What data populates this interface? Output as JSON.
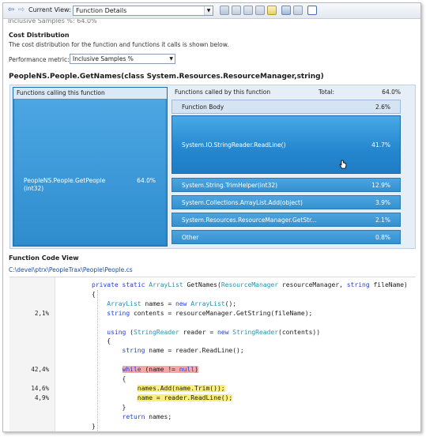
{
  "toolbar": {
    "back_icon": "back-arrow-icon",
    "forward_icon": "forward-arrow-icon",
    "current_view_label": "Current View:",
    "current_view_value": "Function Details",
    "partial_text": "Inclusive Samples %: 64.0%"
  },
  "cost": {
    "title": "Cost Distribution",
    "description": "The cost distribution for the function and functions it calls is shown below.",
    "metric_label": "Performance metric:",
    "metric_value": "Inclusive Samples %"
  },
  "function_title": "PeopleNS.People.GetNames(class System.Resources.ResourceManager,string)",
  "callers": {
    "header": "Functions calling this function",
    "items": [
      {
        "name": "PeopleNS.People.GetPeople (int32)",
        "value": "64.0%"
      }
    ]
  },
  "callees": {
    "header": "Functions called by this function",
    "total_label": "Total:",
    "total_value": "64.0%",
    "items": [
      {
        "name": "Function Body",
        "value": "2.6%"
      },
      {
        "name": "System.IO.StringReader.ReadLine()",
        "value": "41.7%"
      },
      {
        "name": "System.String.TrimHelper(int32)",
        "value": "12.9%"
      },
      {
        "name": "System.Collections.ArrayList.Add(object)",
        "value": "3.9%"
      },
      {
        "name": "System.Resources.ResourceManager.GetStr...",
        "value": "2.1%"
      },
      {
        "name": "Other",
        "value": "0.8%"
      }
    ]
  },
  "code_view": {
    "title": "Function Code View",
    "path": "C:\\devel\\ptrx\\PeopleTrax\\People\\People.cs",
    "gutter": [
      "",
      "",
      "",
      "2,1%",
      "",
      "",
      "",
      "",
      "",
      "42,4%",
      "",
      "14,6%",
      "4,9%",
      "",
      "",
      ""
    ],
    "lines": [
      "private static ArrayList GetNames(ResourceManager resourceManager, string fileName)",
      "{",
      "    ArrayList names = new ArrayList();",
      "    string contents = resourceManager.GetString(fileName);",
      "",
      "    using (StringReader reader = new StringReader(contents))",
      "    {",
      "        string name = reader.ReadLine();",
      "",
      "        while (name != null)",
      "        {",
      "            names.Add(name.Trim());",
      "            name = reader.ReadLine();",
      "        }",
      "        return names;",
      "}"
    ]
  },
  "colors": {
    "accent_blue": "#2a86c8",
    "hot_line": "#f5a6a6",
    "warm_line": "#f8f07a"
  }
}
